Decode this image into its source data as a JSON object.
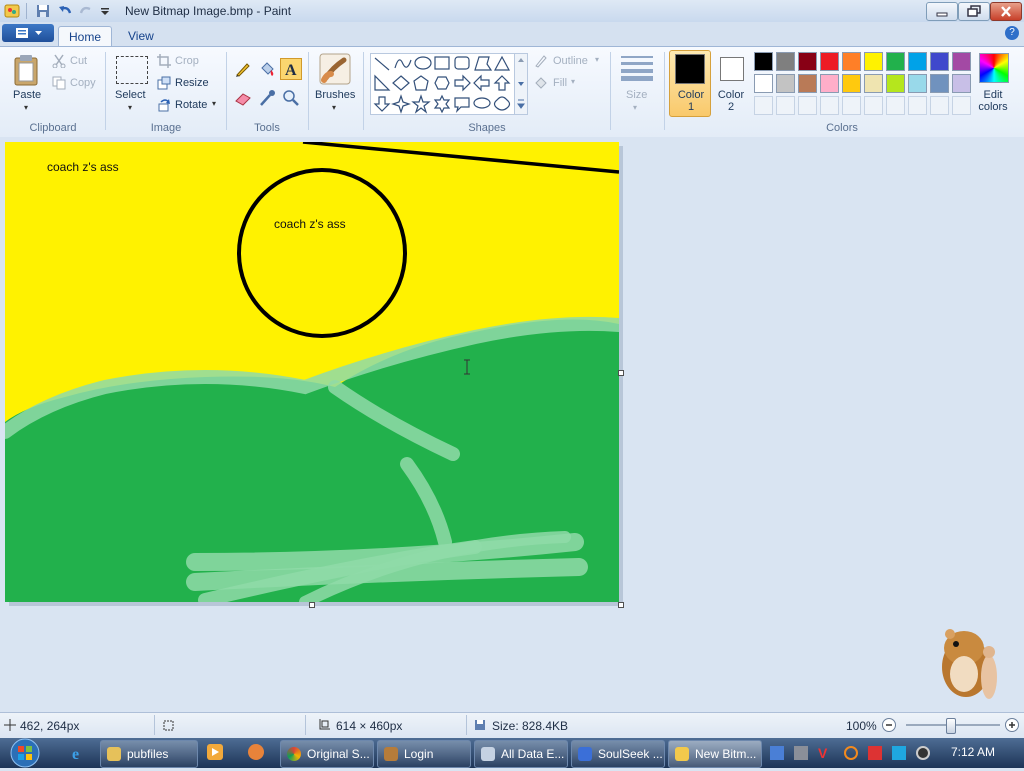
{
  "window": {
    "title": "New Bitmap Image.bmp - Paint"
  },
  "tabs": [
    {
      "label": "Home"
    },
    {
      "label": "View"
    }
  ],
  "clipboard": {
    "group": "Clipboard",
    "paste": "Paste",
    "cut": "Cut",
    "copy": "Copy"
  },
  "image": {
    "group": "Image",
    "select": "Select",
    "crop": "Crop",
    "resize": "Resize",
    "rotate": "Rotate"
  },
  "tools": {
    "group": "Tools",
    "brushes": "Brushes"
  },
  "shapes": {
    "group": "Shapes",
    "outline": "Outline",
    "fill": "Fill",
    "size": "Size"
  },
  "colors": {
    "group": "Colors",
    "color1": "Color 1",
    "color2": "Color 2",
    "edit": "Edit colors",
    "color1_value": "#000000",
    "color2_value": "#ffffff",
    "palette_row1": [
      "#000000",
      "#7f7f7f",
      "#880015",
      "#ed1c24",
      "#ff7f27",
      "#fff200",
      "#22b14c",
      "#00a2e8",
      "#3f48cc",
      "#a349a4"
    ],
    "palette_row2": [
      "#ffffff",
      "#c3c3c3",
      "#b97a57",
      "#ffaec9",
      "#ffc90e",
      "#efe4b0",
      "#b5e61d",
      "#99d9ea",
      "#7092be",
      "#c8bfe7"
    ]
  },
  "canvas": {
    "text1": "coach z's ass",
    "text2": "coach z's ass",
    "sky_color": "#fff200",
    "grass_color": "#22b14c"
  },
  "status": {
    "cursor_pos": "462, 264px",
    "canvas_size": "614 × 460px",
    "file_size": "Size: 828.4KB",
    "zoom": "100%"
  },
  "taskbar": {
    "items": [
      {
        "label": "pubfiles"
      },
      {
        "label": "Original S..."
      },
      {
        "label": "Login"
      },
      {
        "label": "All Data E..."
      },
      {
        "label": "SoulSeek ..."
      },
      {
        "label": "New Bitm..."
      }
    ],
    "clock": "7:12 AM"
  }
}
